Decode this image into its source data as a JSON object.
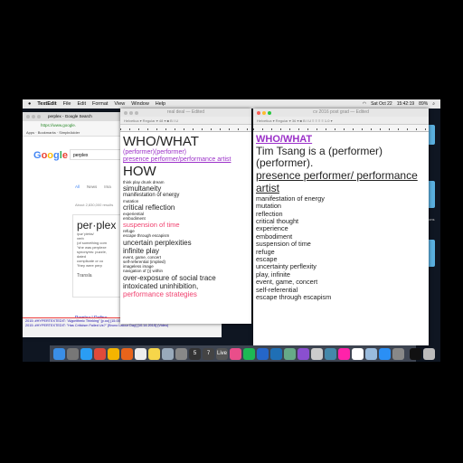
{
  "menubar": {
    "app": "TextEdit",
    "items": [
      "File",
      "Edit",
      "Format",
      "View",
      "Window",
      "Help"
    ],
    "status": {
      "date": "Sat Oct 22",
      "time": "15:42:19",
      "battery": "89%"
    }
  },
  "chrome": {
    "tab": "perplex - Google Search",
    "address": "https://www.google.",
    "bookmarks": [
      "Apps",
      "Bookmarks",
      "SimpleAdder"
    ],
    "logo": [
      "G",
      "o",
      "o",
      "g",
      "l",
      "e"
    ],
    "query": "perplex",
    "tabs": [
      "All",
      "News",
      "Ima"
    ],
    "about": "About 2,830,000 results",
    "card": {
      "word": "per·plex",
      "pron": "/pərˈpleks/",
      "pos": "verb",
      "def1": "(of something com",
      "ex1": "\"she was perplexe",
      "syn": "synonyms: puzzle,",
      "def2": "dated",
      "def2b": "complicate or co",
      "ex2": "\"they were perp",
      "translate": "Transla"
    },
    "result": {
      "title": "Perplex | Define",
      "url": "www.dictionary.com/b",
      "desc": "Perplex definition, to cause to be puzzled or bewildered over what is not understood or certain"
    }
  },
  "links": [
    "2015: #HYPERTEXTEDIT: \"Algorithmic Thinking\" [p.oo] [15.00] [.end] [10.22.2015] #SuperCollider #Pyroraze (Video)",
    "2015: #HYPERTEXTEDIT: \"Has Criticism Failed Us?\" [Bruno Latour Day] [10.14.2015] (Video)"
  ],
  "mid": {
    "title": "real deal — Edited",
    "lines": [
      {
        "t": "WHO/WHAT",
        "s": 15,
        "c": ""
      },
      {
        "t": "(performer)(performer)",
        "s": 7,
        "c": "purple"
      },
      {
        "t": "presence performer/performance artist",
        "s": 7,
        "c": "purple u"
      },
      {
        "t": "HOW",
        "s": 15,
        "c": ""
      },
      {
        "t": "think play drunk dream",
        "s": 4.5,
        "c": ""
      },
      {
        "t": "simultaneity",
        "s": 8,
        "c": ""
      },
      {
        "t": "manifestation of energy",
        "s": 6,
        "c": ""
      },
      {
        "t": "mutation",
        "s": 4.5,
        "c": ""
      },
      {
        "t": "critical reflection",
        "s": 8,
        "c": ""
      },
      {
        "t": "experiential",
        "s": 4.5,
        "c": ""
      },
      {
        "t": "embodiment",
        "s": 4.5,
        "c": ""
      },
      {
        "t": "suspension of time",
        "s": 7.5,
        "c": "pink"
      },
      {
        "t": "refuge",
        "s": 4.5,
        "c": ""
      },
      {
        "t": "escape through escapism",
        "s": 4.5,
        "c": ""
      },
      {
        "t": "uncertain perplexities",
        "s": 8,
        "c": ""
      },
      {
        "t": "infinite play",
        "s": 8,
        "c": ""
      },
      {
        "t": "event, game, concert",
        "s": 4.5,
        "c": ""
      },
      {
        "t": "self-referential (implied)",
        "s": 4.5,
        "c": ""
      },
      {
        "t": "imageless image",
        "s": 4.5,
        "c": ""
      },
      {
        "t": "navigation of ))) within",
        "s": 4.5,
        "c": ""
      },
      {
        "t": "over-exposure of social trace",
        "s": 8,
        "c": ""
      },
      {
        "t": "intoxicated uninhibition,",
        "s": 8,
        "c": ""
      },
      {
        "t": "performance strategies",
        "s": 8,
        "c": "pink"
      }
    ]
  },
  "right": {
    "title": "cv 2016 post grad — Edited",
    "lines": [
      {
        "t": "WHO/WHAT",
        "s": 11,
        "c": "purple u b"
      },
      {
        "t": "Tim Tsang is a (performer) (performer).",
        "s": 12,
        "c": ""
      },
      {
        "t": "presence performer/ performance artist",
        "s": 12,
        "c": "u"
      },
      {
        "t": "manifestation of energy",
        "s": 7.3,
        "c": ""
      },
      {
        "t": "mutation",
        "s": 7.3,
        "c": ""
      },
      {
        "t": "reflection",
        "s": 7.3,
        "c": ""
      },
      {
        "t": "critical thought",
        "s": 7.3,
        "c": ""
      },
      {
        "t": "experience",
        "s": 7.3,
        "c": ""
      },
      {
        "t": "embodiment",
        "s": 7.3,
        "c": ""
      },
      {
        "t": "suspension of time",
        "s": 7.3,
        "c": ""
      },
      {
        "t": "refuge",
        "s": 7.3,
        "c": ""
      },
      {
        "t": "escape",
        "s": 7.3,
        "c": ""
      },
      {
        "t": "uncertainty perflexity",
        "s": 7.3,
        "c": ""
      },
      {
        "t": "play, infinite",
        "s": 7.3,
        "c": ""
      },
      {
        "t": "event, game, concert",
        "s": 7.3,
        "c": ""
      },
      {
        "t": "self-referential",
        "s": 7.3,
        "c": ""
      },
      {
        "t": "escape through escapism",
        "s": 7.3,
        "c": ""
      }
    ]
  },
  "side_label": "tions",
  "dock": [
    {
      "n": "finder",
      "c": "#3a8ee6"
    },
    {
      "n": "launchpad",
      "c": "#777"
    },
    {
      "n": "safari",
      "c": "#2a9df4"
    },
    {
      "n": "chrome",
      "c": "#e04a3a"
    },
    {
      "n": "drive",
      "c": "#f4b400"
    },
    {
      "n": "firefox",
      "c": "#e8641b"
    },
    {
      "n": "textedit",
      "c": "#eee"
    },
    {
      "n": "notes",
      "c": "#f6d64a"
    },
    {
      "n": "app",
      "c": "#9ab"
    },
    {
      "n": "app",
      "c": "#888"
    },
    {
      "n": "app",
      "c": "#333",
      "l": "5"
    },
    {
      "n": "app",
      "c": "#444",
      "l": "7"
    },
    {
      "n": "live",
      "c": "#555",
      "l": "Live"
    },
    {
      "n": "itunes",
      "c": "#e94e8a"
    },
    {
      "n": "spotify",
      "c": "#1db954"
    },
    {
      "n": "app",
      "c": "#2566c9"
    },
    {
      "n": "app",
      "c": "#1f6fb5"
    },
    {
      "n": "app",
      "c": "#6a8"
    },
    {
      "n": "imovie",
      "c": "#8a4fd0"
    },
    {
      "n": "app",
      "c": "#ccc"
    },
    {
      "n": "app",
      "c": "#48a"
    },
    {
      "n": "photos",
      "c": "#f2a"
    },
    {
      "n": "calendar",
      "c": "#fff"
    },
    {
      "n": "preview",
      "c": "#9bd"
    },
    {
      "n": "messages",
      "c": "#2a8ff5"
    },
    {
      "n": "preferences",
      "c": "#888"
    },
    {
      "n": "window",
      "c": "#111"
    },
    {
      "n": "trash",
      "c": "#bbb"
    }
  ]
}
